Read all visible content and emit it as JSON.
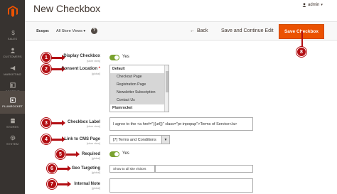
{
  "sidebar": {
    "logo": "magento-logo-icon",
    "items": [
      {
        "label": "Sales",
        "icon": "dollar-icon"
      },
      {
        "label": "Customers",
        "icon": "person-icon"
      },
      {
        "label": "Marketing",
        "icon": "megaphone-icon"
      },
      {
        "label": "Content",
        "icon": "layout-icon"
      },
      {
        "label": "Plumrocket",
        "icon": "plumrocket-icon"
      },
      {
        "label": "Stores",
        "icon": "store-icon"
      },
      {
        "label": "System",
        "icon": "gear-icon"
      }
    ]
  },
  "header": {
    "title": "New Checkbox",
    "user": "admin"
  },
  "actionbar": {
    "scope_label": "Scope:",
    "scope_value": "All Store Views",
    "help_glyph": "?",
    "back": "Back",
    "save_continue": "Save and Continue Edit",
    "save": "Save Checkbox"
  },
  "markers": [
    "1",
    "2",
    "3",
    "4",
    "5",
    "6",
    "7",
    "8"
  ],
  "form": {
    "display_checkbox": {
      "label": "Display Checkbox",
      "scope": "[store view]",
      "value": "Yes"
    },
    "consent_location": {
      "label": "Consent Location",
      "scope": "[global]",
      "groups": [
        {
          "name": "Default",
          "options": [
            "Checkout Page",
            "Registration Page",
            "Newsletter Subscription",
            "Contact Us"
          ]
        },
        {
          "name": "Plumrocket",
          "options": []
        }
      ]
    },
    "checkbox_label": {
      "label": "Checkbox Label",
      "scope": "[store view]",
      "value": "I agree to the <a href=\"{{url}}\" class=\"pr-inpopup\">Terms of Service</a>"
    },
    "cms_page": {
      "label": "Link to CMS Page",
      "scope": "[store view]",
      "value": "[7] Terms and Conditions"
    },
    "required": {
      "label": "Required",
      "scope": "[global]",
      "value": "Yes"
    },
    "geo_targeting": {
      "label": "Geo Targeting",
      "scope": "[global]",
      "value": "Show to all site visitors"
    },
    "internal_note": {
      "label": "Internal Note",
      "scope": "[global]",
      "value": ""
    }
  },
  "colors": {
    "accent": "#eb5202",
    "marker": "#b30f14",
    "toggle_on": "#79a22e",
    "sidebar": "#373330"
  }
}
